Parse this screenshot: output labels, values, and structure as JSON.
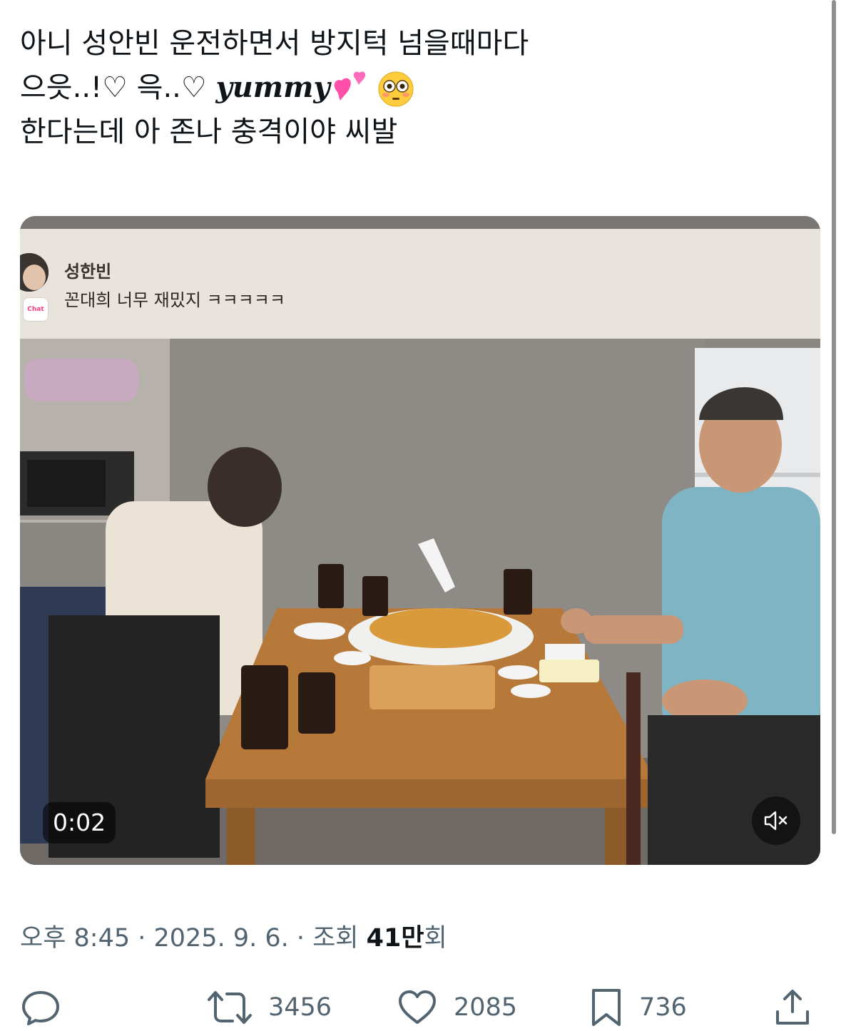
{
  "tweet": {
    "line1": "아니 성안빈 운전하면서 방지턱 넘을때마다",
    "line2_prefix": "으읏..!♡ 윽..♡ ",
    "line2_word": "yummy",
    "line3": "한다는데 아 존나 충격이야 씨발",
    "emoji_1": "two-hearts-icon",
    "emoji_2": "flushed-face-icon"
  },
  "video": {
    "overlay_name": "성한빈",
    "overlay_message": "꼰대희 너무 재밌지 ㅋㅋㅋㅋㅋ",
    "chat_badge": "Chat",
    "elapsed": "0:02",
    "muted": true
  },
  "meta": {
    "time_prefix": "오후 8:45 · 2025. 9. 6. · 조회 ",
    "views": "41만",
    "views_suffix": "회"
  },
  "actions": {
    "reply_count": "",
    "retweet_count": "3456",
    "like_count": "2085",
    "bookmark_count": "736"
  },
  "colors": {
    "text": "#0f1419",
    "muted": "#536471"
  }
}
